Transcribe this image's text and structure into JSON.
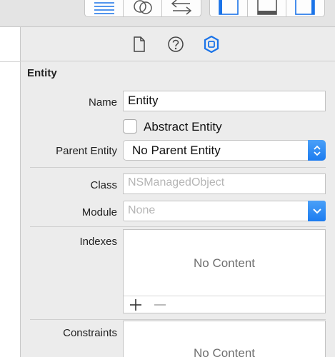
{
  "toolbar": {
    "editor_group": [
      {
        "icon": "standard-editor-icon",
        "active": true
      },
      {
        "icon": "assistant-editor-icon",
        "active": false
      },
      {
        "icon": "version-editor-icon",
        "active": false
      }
    ],
    "view_group": [
      {
        "icon": "navigator-toggle-icon",
        "active": true
      },
      {
        "icon": "debug-area-toggle-icon",
        "active": false
      },
      {
        "icon": "utilities-toggle-icon",
        "active": true
      }
    ],
    "accent_color": "#1a73e8"
  },
  "inspector": {
    "tabs": [
      {
        "icon": "file-inspector-icon",
        "active": false
      },
      {
        "icon": "quick-help-icon",
        "active": false
      },
      {
        "icon": "data-model-inspector-icon",
        "active": true
      }
    ],
    "section_title": "Entity",
    "name_label": "Name",
    "name_value": "Entity",
    "abstract_label": "Abstract Entity",
    "abstract_checked": false,
    "parent_label": "Parent Entity",
    "parent_value": "No Parent Entity",
    "class_label": "Class",
    "class_placeholder": "NSManagedObject",
    "module_label": "Module",
    "module_placeholder": "None",
    "indexes_label": "Indexes",
    "indexes_empty": "No Content",
    "constraints_label": "Constraints",
    "constraints_empty": "No Content",
    "add_symbol": "+",
    "remove_symbol": "−"
  }
}
